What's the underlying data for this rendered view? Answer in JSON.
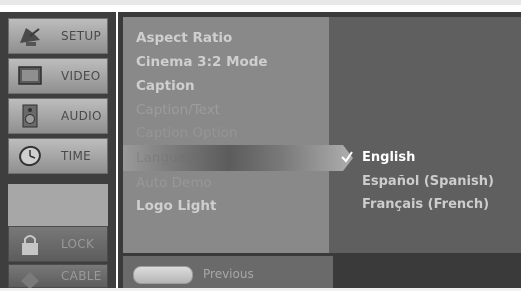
{
  "sidebar": {
    "items": [
      {
        "label": "SETUP",
        "icon": "satellite-dish-icon"
      },
      {
        "label": "VIDEO",
        "icon": "tv-screen-icon"
      },
      {
        "label": "AUDIO",
        "icon": "speaker-icon"
      },
      {
        "label": "TIME",
        "icon": "clock-icon"
      },
      {
        "label": "LOCK",
        "icon": "padlock-icon"
      },
      {
        "label": "CABLE",
        "icon": "cable-icon"
      }
    ]
  },
  "menu": {
    "options": [
      "Aspect Ratio",
      "Cinema 3:2 Mode",
      "Caption",
      "Caption/Text",
      "Caption Option",
      "Language",
      "Auto Demo",
      "Logo Light"
    ],
    "selected_index": 5
  },
  "submenu": {
    "languages": [
      "English",
      "Español (Spanish)",
      "Français (French)"
    ],
    "checked_index": 0
  },
  "footer": {
    "previous_label": "Previous"
  }
}
